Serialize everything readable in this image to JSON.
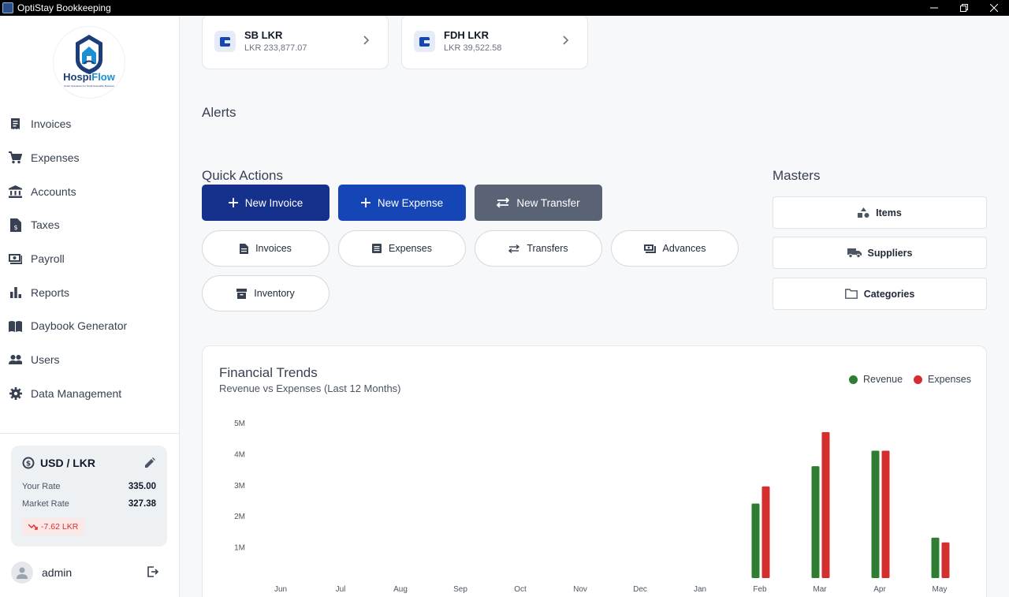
{
  "window": {
    "title": "OptiStay Bookkeeping"
  },
  "logo": {
    "brand_a": "Hospi",
    "brand_b": "Flow",
    "tagline": "Smart Operations for Small Hospitality Business"
  },
  "sidebar": {
    "items": [
      {
        "label": "Invoices",
        "icon": "receipt-icon"
      },
      {
        "label": "Expenses",
        "icon": "cart-icon"
      },
      {
        "label": "Accounts",
        "icon": "bank-icon"
      },
      {
        "label": "Taxes",
        "icon": "tax-doc-icon"
      },
      {
        "label": "Payroll",
        "icon": "payroll-icon"
      },
      {
        "label": "Reports",
        "icon": "bar-chart-icon"
      },
      {
        "label": "Daybook Generator",
        "icon": "book-icon"
      },
      {
        "label": "Users",
        "icon": "users-icon"
      },
      {
        "label": "Data Management",
        "icon": "gear-icon"
      }
    ]
  },
  "rate_card": {
    "title": "USD / LKR",
    "your_rate_label": "Your Rate",
    "your_rate": "335.00",
    "market_rate_label": "Market Rate",
    "market_rate": "327.38",
    "diff": "-7.62 LKR"
  },
  "user": {
    "name": "admin"
  },
  "accounts": [
    {
      "name": "SB LKR",
      "balance": "LKR 233,877.07"
    },
    {
      "name": "FDH LKR",
      "balance": "LKR 39,522.58"
    }
  ],
  "sections": {
    "alerts": "Alerts",
    "quick_actions": "Quick Actions",
    "masters": "Masters"
  },
  "quick_actions": {
    "new_invoice": "New Invoice",
    "new_expense": "New Expense",
    "new_transfer": "New Transfer",
    "invoices": "Invoices",
    "expenses": "Expenses",
    "transfers": "Transfers",
    "advances": "Advances",
    "inventory": "Inventory"
  },
  "masters": {
    "items": "Items",
    "suppliers": "Suppliers",
    "categories": "Categories"
  },
  "colors": {
    "revenue": "#2e7d32",
    "expenses": "#d32f2f",
    "primary": "#15318c"
  },
  "chart_data": {
    "type": "bar",
    "title": "Financial Trends",
    "subtitle": "Revenue vs Expenses (Last 12 Months)",
    "categories": [
      "Jun",
      "Jul",
      "Aug",
      "Sep",
      "Oct",
      "Nov",
      "Dec",
      "Jan",
      "Feb",
      "Mar",
      "Apr",
      "May"
    ],
    "series": [
      {
        "name": "Revenue",
        "values": [
          0,
          0,
          0,
          0,
          0,
          0,
          0,
          0,
          2.4,
          3.6,
          4.1,
          1.3
        ]
      },
      {
        "name": "Expenses",
        "values": [
          0,
          0,
          0,
          0,
          0,
          0,
          0,
          0,
          2.95,
          4.7,
          4.1,
          1.15
        ]
      }
    ],
    "yticks": [
      "1M",
      "2M",
      "3M",
      "4M",
      "5M"
    ],
    "ylim": [
      0,
      5
    ],
    "legend": "top-right",
    "grid": false
  }
}
